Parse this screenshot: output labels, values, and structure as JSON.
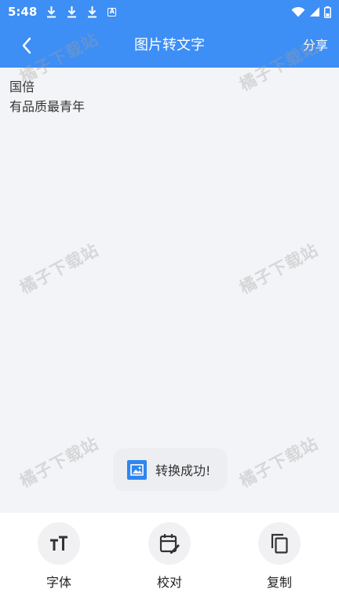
{
  "status_bar": {
    "time": "5:48",
    "badge": "A",
    "icons": [
      "download-icon",
      "download-icon",
      "download-icon",
      "accessibility-icon",
      "wifi-icon",
      "signal-icon",
      "battery-icon"
    ]
  },
  "app_bar": {
    "title": "图片转文字",
    "share_label": "分享",
    "back_icon": "chevron-left-icon"
  },
  "content": {
    "lines": [
      "国倍",
      "有品质最青年"
    ]
  },
  "watermark_text": "橘子下载站",
  "toast": {
    "message": "转换成功!",
    "icon": "image-icon"
  },
  "toolbar": {
    "items": [
      {
        "label": "字体",
        "icon": "text-size-icon"
      },
      {
        "label": "校对",
        "icon": "calendar-edit-icon"
      },
      {
        "label": "复制",
        "icon": "copy-icon"
      }
    ]
  },
  "colors": {
    "accent": "#3d8ef5",
    "background": "#f3f4f7",
    "toast_icon": "#2f86ee"
  }
}
